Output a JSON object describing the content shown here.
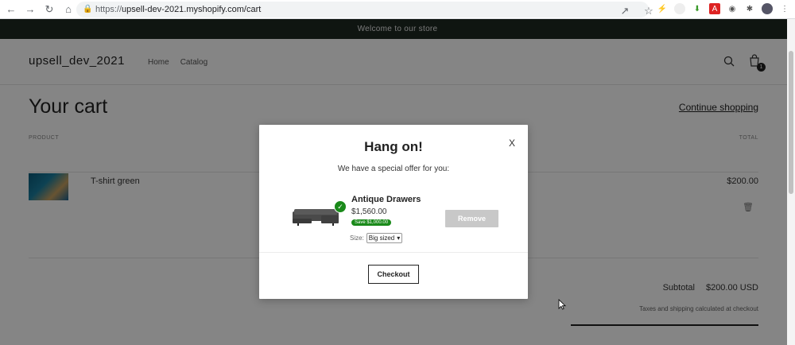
{
  "browser": {
    "url_proto": "https://",
    "url_rest": "upsell-dev-2021.myshopify.com/cart"
  },
  "store": {
    "announcement": "Welcome to our store",
    "logo": "upsell_dev_2021",
    "nav": [
      "Home",
      "Catalog"
    ],
    "cart_count": "1"
  },
  "cart": {
    "title": "Your cart",
    "continue_label": "Continue shopping",
    "col_product": "PRODUCT",
    "col_total": "TOTAL",
    "item_name": "T-shirt green",
    "item_price": "$200.00",
    "subtotal_label": "Subtotal",
    "subtotal_value": "$200.00 USD",
    "taxes_note": "Taxes and shipping calculated at checkout"
  },
  "modal": {
    "close_label": "X",
    "title": "Hang on!",
    "subtitle": "We have a special offer for you:",
    "offer_name": "Antique Drawers",
    "offer_price": "$1,560.00",
    "save_label": "Save $1,000.00",
    "size_label": "Size:",
    "size_value": "Big sized",
    "remove_label": "Remove",
    "checkout_label": "Checkout"
  },
  "colors": {
    "accent_green": "#1a8a1a",
    "announce_bg": "#1e2a22"
  }
}
